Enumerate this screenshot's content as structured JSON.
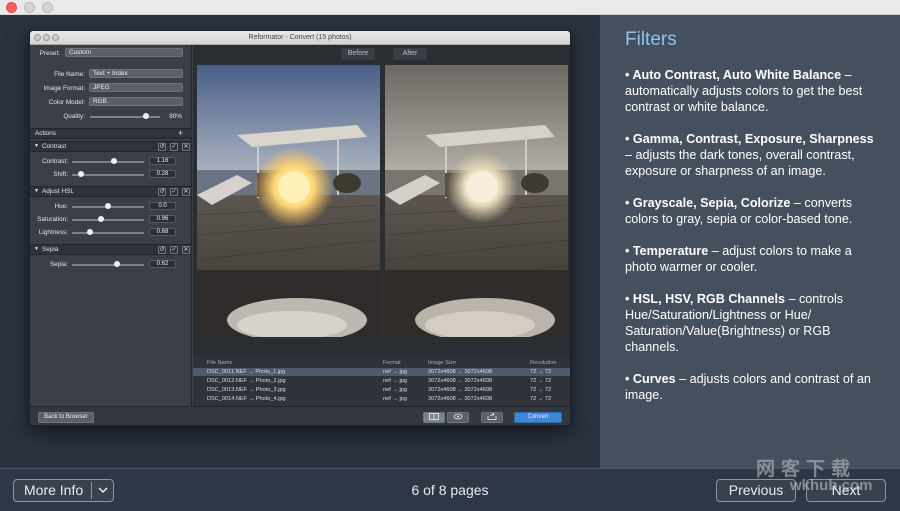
{
  "sidebar": {
    "title": "Filters",
    "features": [
      {
        "bold": "• Auto Contrast, Auto White Balance",
        "text": " – automatically adjusts colors to get the best contrast or white balance."
      },
      {
        "bold": "• Gamma, Contrast, Exposure, Sharpness",
        "text": "  –  adjusts the dark tones, overall contrast, exposure or sharpness of an image."
      },
      {
        "bold": "• Grayscale, Sepia, Colorize",
        "text": "  – converts colors to gray, sepia or color-based tone."
      },
      {
        "bold": "• Temperature",
        "text": "  – adjust colors to make a photo warmer or cooler."
      },
      {
        "bold": "• HSL, HSV, RGB Channels",
        "text": "  – controls Hue/Saturation/Lightness or Hue/ Saturation/Value(Brightness) or RGB channels."
      },
      {
        "bold": "• Curves",
        "text": "  – adjusts colors and contrast of an image."
      }
    ]
  },
  "footer": {
    "more_info": "More Info",
    "page_indicator": "6 of 8 pages",
    "previous": "Previous",
    "next": "Next"
  },
  "watermark": {
    "line1": "网客下载",
    "line2": "wkhub.com"
  },
  "app": {
    "title": "Reformator - Convert (15 photos)",
    "preset_label": "Preset:",
    "preset_value": "Custom",
    "file_name_label": "File Name:",
    "file_name_value": "Text + Index",
    "image_format_label": "Image Format:",
    "image_format_value": "JPEG",
    "color_model_label": "Color Model:",
    "color_model_value": "RGB",
    "quality_label": "Quality:",
    "quality_value": "80%",
    "quality_fraction": 0.8,
    "actions_label": "Actions",
    "actions_add": "+",
    "sections": [
      {
        "name": "Contrast",
        "controls": [
          {
            "label": "Contrast:",
            "value": "1.16",
            "fraction": 0.58
          },
          {
            "label": "Shift:",
            "value": "0.28",
            "fraction": 0.12
          }
        ]
      },
      {
        "name": "Adjust HSL",
        "controls": [
          {
            "label": "Hue:",
            "value": "0.0",
            "fraction": 0.5
          },
          {
            "label": "Saturation:",
            "value": "0.96",
            "fraction": 0.4
          },
          {
            "label": "Lightness:",
            "value": "0.68",
            "fraction": 0.25
          }
        ]
      },
      {
        "name": "Sepia",
        "controls": [
          {
            "label": "Sepia:",
            "value": "0.62",
            "fraction": 0.62
          }
        ]
      }
    ],
    "before_label": "Before",
    "after_label": "After",
    "columns": [
      "File Name",
      "Format",
      "Image Size",
      "Resolution"
    ],
    "files": [
      [
        "DSC_0011.NEF → Photo_1.jpg",
        "nef → jpg",
        "3072x4608 → 3072x4608",
        "72 → 72"
      ],
      [
        "DSC_0012.NEF → Photo_2.jpg",
        "nef → jpg",
        "3072x4608 → 3072x4608",
        "72 → 72"
      ],
      [
        "DSC_0013.NEF → Photo_3.jpg",
        "nef → jpg",
        "3072x4608 → 3072x4608",
        "72 → 72"
      ],
      [
        "DSC_0014.NEF → Photo_4.jpg",
        "nef → jpg",
        "3072x4608 → 3072x4608",
        "72 → 72"
      ]
    ],
    "back_button": "Back to Browser",
    "convert_button": "Convert"
  }
}
